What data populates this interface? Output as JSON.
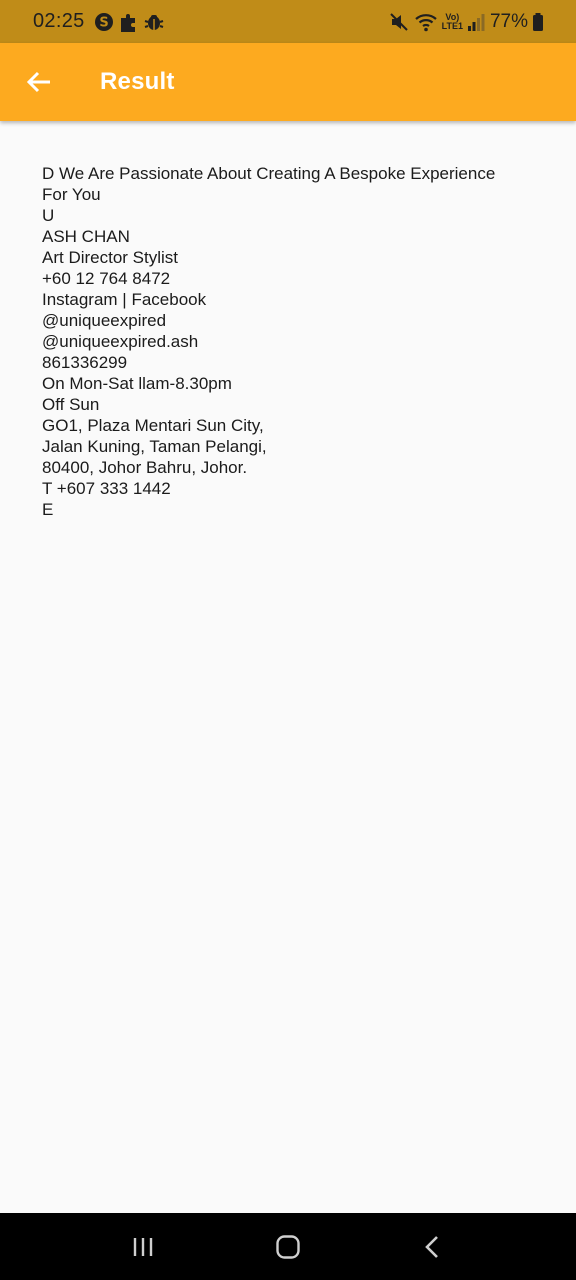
{
  "status_bar": {
    "time": "02:25",
    "battery_percent": "77%",
    "network_label_top": "Vo)",
    "network_label_bottom": "LTE1",
    "icons": [
      "s-circle-icon",
      "puzzle-icon",
      "bug-icon",
      "mute-icon",
      "wifi-icon",
      "signal-icon",
      "battery-icon"
    ]
  },
  "app_bar": {
    "title": "Result",
    "background": "#fdaa1f",
    "back_icon": "arrow-back-icon"
  },
  "result_lines": [
    "D We Are Passionate About Creating A Bespoke Experience",
    "For You",
    "U",
    "ASH CHAN",
    "Art Director Stylist",
    "+60 12 764 8472",
    "Instagram | Facebook",
    "@uniqueexpired",
    "@uniqueexpired.ash",
    "861336299",
    "On Mon-Sat llam-8.30pm",
    "Off Sun",
    "GO1, Plaza Mentari Sun City,",
    "Jalan Kuning, Taman Pelangi,",
    "80400, Johor Bahru, Johor.",
    "T +607 333 1442",
    "E"
  ],
  "nav_bar": {
    "icons": [
      "recent-apps-icon",
      "home-icon",
      "back-nav-icon"
    ]
  }
}
